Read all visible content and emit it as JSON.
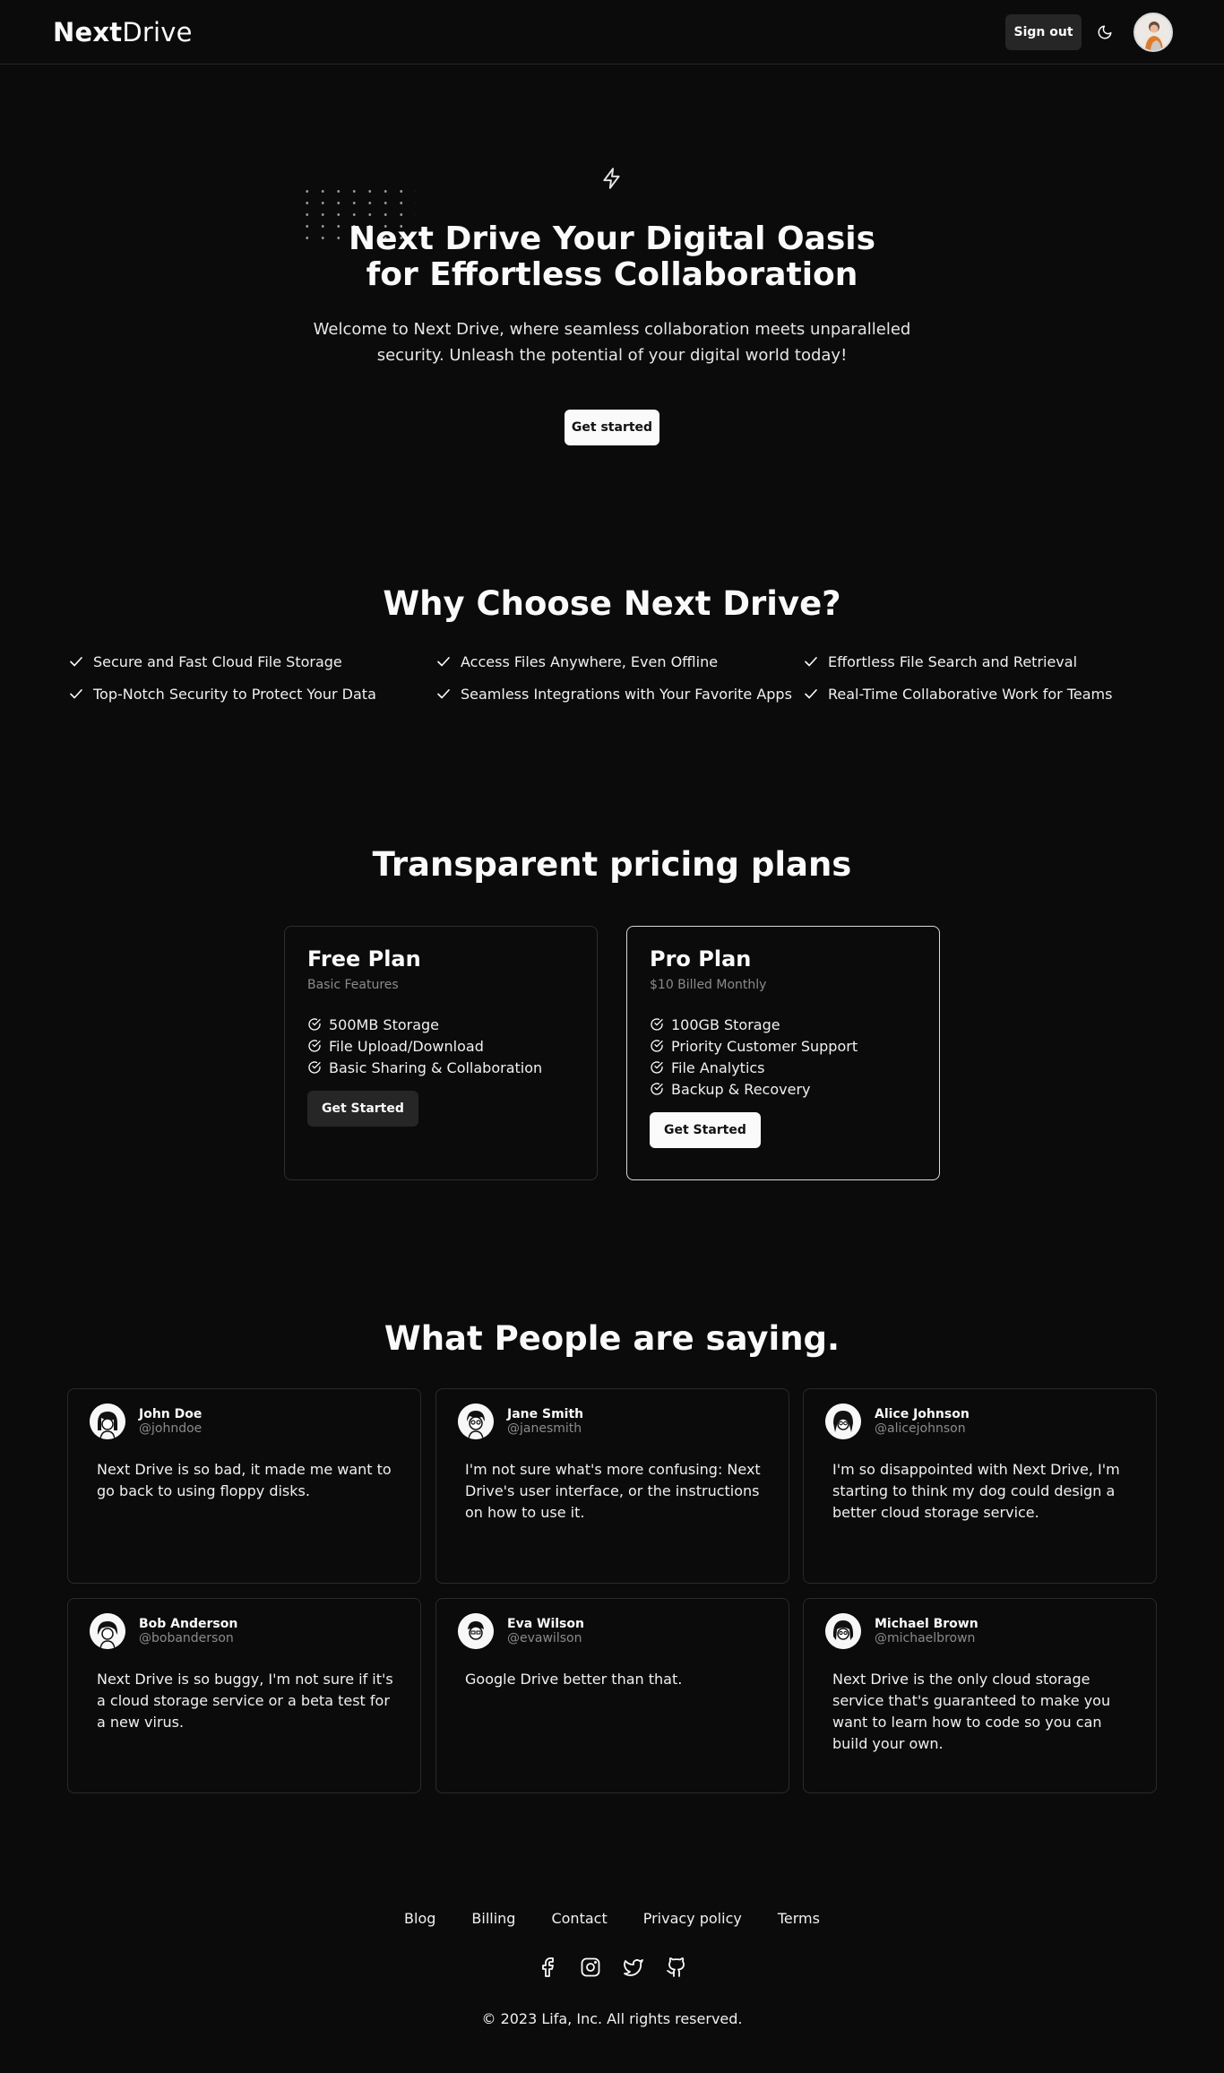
{
  "header": {
    "logo_bold": "Next",
    "logo_light": "Drive",
    "signout_label": "Sign out",
    "theme_icon": "moon-icon",
    "avatar_icon": "user-avatar"
  },
  "hero": {
    "title_line1": "Next Drive Your Digital Oasis",
    "title_line2": "for Effortless Collaboration",
    "subtitle_line1": "Welcome to Next Drive, where seamless collaboration meets unparalleled",
    "subtitle_line2": "security. Unleash the potential of your digital world today!",
    "cta_label": "Get started",
    "icon": "lightning-icon"
  },
  "features": {
    "title": "Why Choose Next Drive?",
    "items": [
      "Secure and Fast Cloud File Storage",
      "Access Files Anywhere, Even Offline",
      "Effortless File Search and Retrieval",
      "Top-Notch Security to Protect Your Data",
      "Seamless Integrations with Your Favorite Apps",
      "Real-Time Collaborative Work for Teams"
    ]
  },
  "pricing": {
    "title": "Transparent pricing plans",
    "plans": [
      {
        "name": "Free Plan",
        "description": "Basic Features",
        "features": [
          "500MB Storage",
          "File Upload/Download",
          "Basic Sharing & Collaboration"
        ],
        "button_label": "Get Started"
      },
      {
        "name": "Pro Plan",
        "description": "$10 Billed Monthly",
        "features": [
          "100GB Storage",
          "Priority Customer Support",
          "File Analytics",
          "Backup & Recovery"
        ],
        "button_label": "Get Started"
      }
    ]
  },
  "testimonials": {
    "title": "What People are saying.",
    "items": [
      {
        "name": "John Doe",
        "handle": "@johndoe",
        "text": "Next Drive is so bad, it made me want to go back to using floppy disks."
      },
      {
        "name": "Jane Smith",
        "handle": "@janesmith",
        "text": "I'm not sure what's more confusing: Next Drive's user interface, or the instructions on how to use it."
      },
      {
        "name": "Alice Johnson",
        "handle": "@alicejohnson",
        "text": "I'm so disappointed with Next Drive, I'm starting to think my dog could design a better cloud storage service."
      },
      {
        "name": "Bob Anderson",
        "handle": "@bobanderson",
        "text": "Next Drive is so buggy, I'm not sure if it's a cloud storage service or a beta test for a new virus."
      },
      {
        "name": "Eva Wilson",
        "handle": "@evawilson",
        "text": "Google Drive better than that."
      },
      {
        "name": "Michael Brown",
        "handle": "@michaelbrown",
        "text": "Next Drive is the only cloud storage service that's guaranteed to make you want to learn how to code so you can build your own."
      }
    ]
  },
  "footer": {
    "links": [
      "Blog",
      "Billing",
      "Contact",
      "Privacy policy",
      "Terms"
    ],
    "socials": [
      "facebook-icon",
      "instagram-icon",
      "twitter-icon",
      "github-icon"
    ],
    "copyright": "© 2023 Lifa, Inc. All rights reserved."
  }
}
